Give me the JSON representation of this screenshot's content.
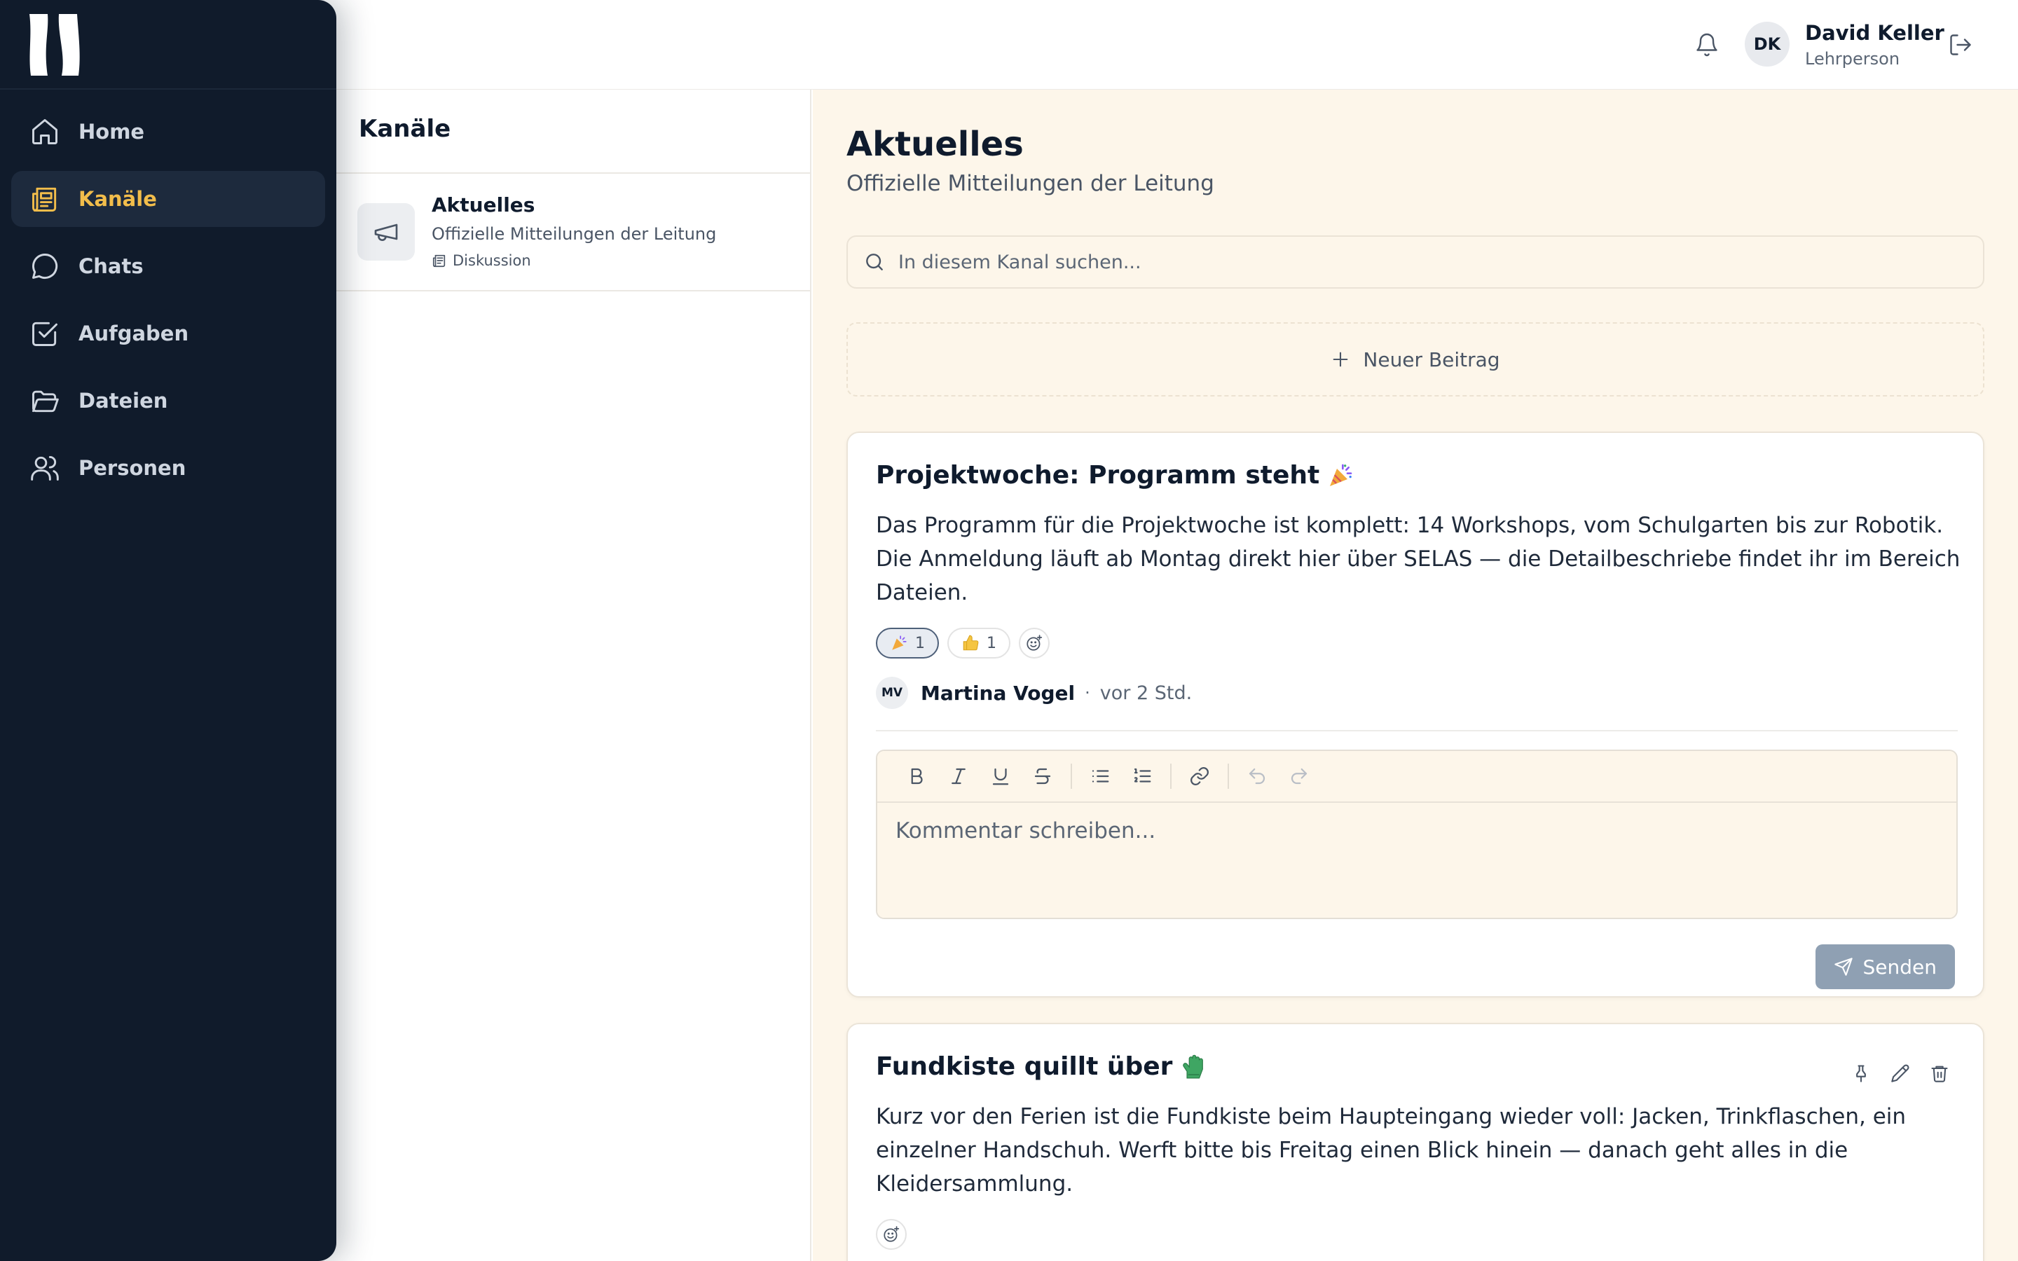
{
  "sidebar": {
    "items": [
      {
        "label": "Home",
        "icon": "home-icon"
      },
      {
        "label": "Kanäle",
        "icon": "newspaper-icon",
        "active": true
      },
      {
        "label": "Chats",
        "icon": "chat-icon"
      },
      {
        "label": "Aufgaben",
        "icon": "checkbox-icon"
      },
      {
        "label": "Dateien",
        "icon": "folder-icon"
      },
      {
        "label": "Personen",
        "icon": "users-icon"
      }
    ]
  },
  "header": {
    "user_initials": "DK",
    "user_name": "David Keller",
    "user_role": "Lehrperson"
  },
  "channels": {
    "title": "Kanäle",
    "items": [
      {
        "name": "Aktuelles",
        "description": "Offizielle Mitteilungen der Leitung",
        "type": "Diskussion",
        "icon": "megaphone-icon"
      }
    ]
  },
  "main": {
    "title": "Aktuelles",
    "subtitle": "Offizielle Mitteilungen der Leitung",
    "search_placeholder": "In diesem Kanal suchen...",
    "new_post_label": "Neuer Beitrag",
    "posts": [
      {
        "title": "Projektwoche: Programm steht",
        "title_icon": "party-popper-icon",
        "body": "Das Programm für die Projektwoche ist komplett: 14 Workshops, vom Schulgarten bis zur Robotik. Die Anmeldung läuft ab Montag direkt hier über SELAS — die Detailbeschriebe findet ihr im Bereich Dateien.",
        "reactions": [
          {
            "emoji": "party-popper-icon",
            "count": "1",
            "active": true
          },
          {
            "emoji": "thumbs-up-icon",
            "count": "1",
            "active": false
          }
        ],
        "author_initials": "MV",
        "author_name": "Martina Vogel",
        "separator": "·",
        "time": "vor 2 Std.",
        "comment_placeholder": "Kommentar schreiben...",
        "send_label": "Senden"
      },
      {
        "title": "Fundkiste quillt über",
        "title_icon": "glove-icon",
        "body": "Kurz vor den Ferien ist die Fundkiste beim Haupteingang wieder voll: Jacken, Trinkflaschen, ein einzelner Handschuh. Werft bitte bis Freitag einen Blick hinein — danach geht alles in die Kleidersammlung."
      }
    ]
  },
  "colors": {
    "sidebar_bg": "#101b2b",
    "accent": "#f2bd4b",
    "main_bg": "#fdf6ea",
    "send_button": "#8fa0b3"
  }
}
